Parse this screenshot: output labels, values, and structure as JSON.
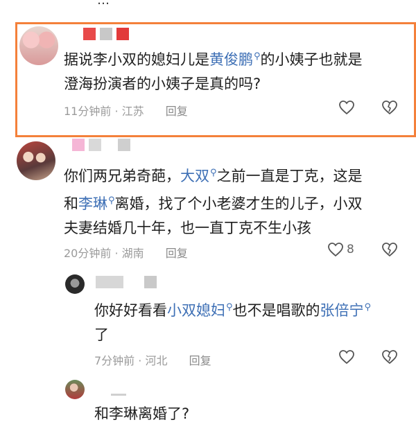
{
  "top_fragment": "…",
  "comments": [
    {
      "text_plain_1": "据说李小双的媳妇儿是",
      "link_1": "黄俊鹏",
      "text_plain_2": "的小姨子也就是",
      "line_2": "澄海扮演者的小姨子是真的吗?",
      "time": "11分钟前",
      "location": "江苏",
      "reply_label": "回复"
    },
    {
      "text_plain_1": "你们两兄弟奇葩，",
      "link_1": "大双",
      "text_plain_2": "之前一直是丁克，这是",
      "line2_plain_1": "和",
      "link_2": "李琳",
      "line2_plain_2": "离婚，找了个小老婆才生的儿子，小双",
      "line_3": "夫妻结婚几十年，也一直丁克不生小孩",
      "time": "20分钟前",
      "location": "湖南",
      "reply_label": "回复",
      "like_count": "8"
    },
    {
      "text_plain_1": "你好好看看",
      "link_1": "小双媳妇",
      "text_plain_2": "也不是唱歌的",
      "link_2": "张倍宁",
      "line_2": "了",
      "time": "7分钟前",
      "location": "河北",
      "reply_label": "回复"
    },
    {
      "text": "和李琳离婚了?"
    }
  ],
  "icons": {
    "search_marker": "search-icon",
    "like": "heart-icon",
    "dislike": "broken-heart-icon"
  },
  "colors": {
    "highlight_border": "#f4803a",
    "link": "#3d6fb5",
    "meta": "#9a9a9a"
  }
}
